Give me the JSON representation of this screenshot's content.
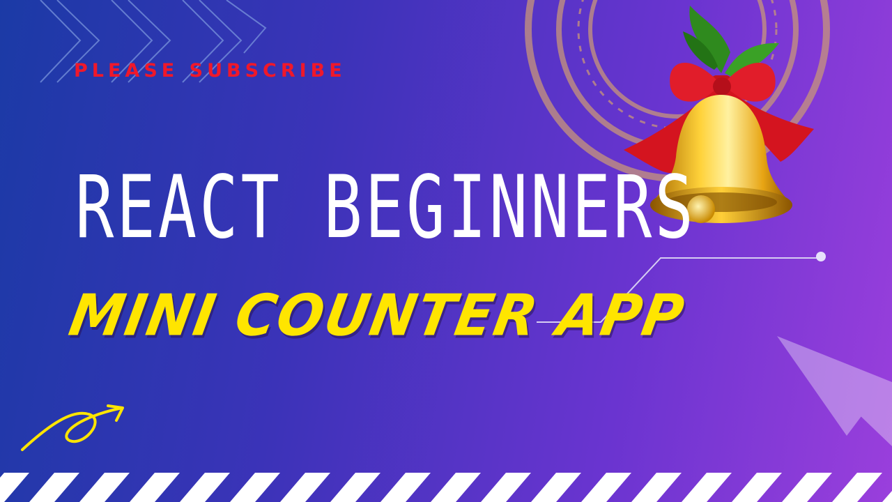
{
  "banner": {
    "subscribe_label": "PLEASE SUBSCRIBE",
    "title": "REACT BEGINNERS",
    "subtitle": "MINI COUNTER APP"
  },
  "icons": {
    "bell": "christmas-bell-icon",
    "arrow": "curly-arrow-icon",
    "plane": "paper-plane-icon",
    "chevrons": "chevron-right-icon"
  },
  "colors": {
    "subscribe": "#f0182a",
    "title": "#ffffff",
    "subtitle": "#ffe500",
    "background_start": "#1b3aa6",
    "background_end": "#9a3fdc"
  }
}
